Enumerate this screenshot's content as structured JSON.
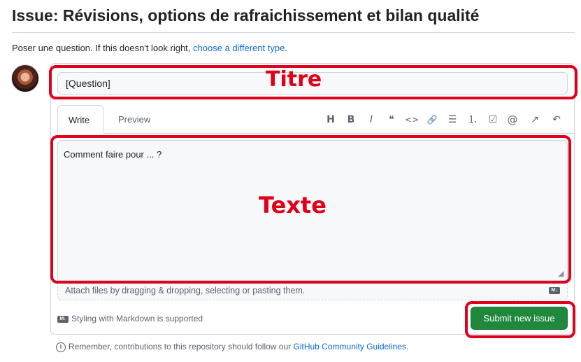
{
  "header": {
    "title": "Issue: Révisions, options de rafraichissement et bilan qualité",
    "subtitle_text": "Poser une question. If this doesn't look right, ",
    "subtitle_link": "choose a different type",
    "subtitle_end": "."
  },
  "form": {
    "title_value": "[Question]",
    "tabs": {
      "write": "Write",
      "preview": "Preview"
    },
    "toolbar": {
      "heading": "H",
      "bold": "B",
      "italic": "I",
      "quote": "❝",
      "code": "<>",
      "link": "🔗",
      "bullet_list": "☰",
      "numbered_list": "⒈",
      "task_list": "☑",
      "mention": "@",
      "reference": "↗",
      "undo": "↶"
    },
    "body_value": "Comment faire pour ... ?",
    "attach_text": "Attach files by dragging & dropping, selecting or pasting them.",
    "markdown_badge": "M↓",
    "markdown_note": "Styling with Markdown is supported",
    "submit_label": "Submit new issue"
  },
  "footer": {
    "guidelines_text": "Remember, contributions to this repository should follow our ",
    "guidelines_link": "GitHub Community Guidelines",
    "guidelines_end": "."
  },
  "annotations": {
    "title_label": "Titre",
    "text_label": "Texte",
    "color": "#e0001b"
  },
  "colors": {
    "submit_green": "#1f883d",
    "link_blue": "#0969da"
  }
}
